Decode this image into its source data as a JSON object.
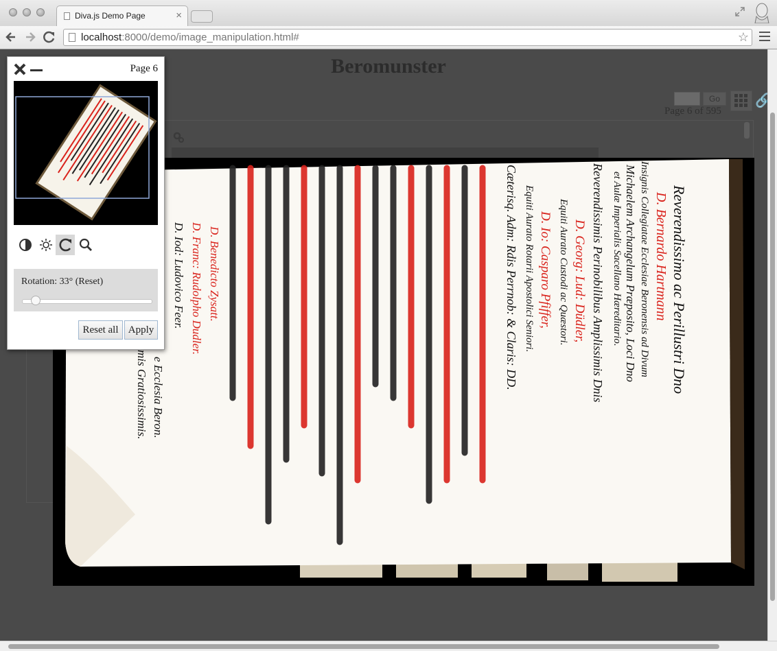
{
  "browser": {
    "tab_title": "Diva.js Demo Page",
    "tab_close": "×",
    "url_host": "localhost",
    "url_path": ":8000/demo/image_manipulation.html#",
    "star": "☆"
  },
  "page": {
    "title": "Beromunster",
    "go_label": "Go",
    "page_count": "Page 6 of 595"
  },
  "panel": {
    "page_label": "Page 6",
    "rotation_label": "Rotation: 33° (Reset)",
    "rotation_degrees": 33,
    "reset_all_label": "Reset all",
    "apply_label": "Apply",
    "tools": [
      "contrast-icon",
      "brightness-icon",
      "rotate-icon",
      "zoom-icon"
    ],
    "active_tool": "rotate-icon"
  },
  "manuscript_text": {
    "col1_lines": [
      "Reverendissimo ac Perillustri Dno",
      "D. Bernardo Hartmann",
      "Insignis Collegiatae Ecclesiae Beronensis ad Divum",
      "Michaelem Archangelum Præposito, Loci Dno",
      "et Aulæ Imperialis Sacellano Hæreditario."
    ],
    "col2_lines": [
      "Reverendissimis Perinobilibus Amplissimis Dnis",
      "D. Georg: Lud: Düdler,",
      "Equiti Aurato Custodi ac Quæstori.",
      "D. Io: Casparo Pfiffer,",
      "Equiti Aurato Rotarii Apostolici Seniori.",
      "Cæterisq. Adm: Rdis Perrnob: & Claris: DD."
    ],
    "names_black": [
      "D. Iod: Ludovico Feer."
    ],
    "names_red": [
      "D. Franc: Rudolpho Dudler.",
      "D. Benedicto Zysatt."
    ],
    "continuation": [
      "mis Gratiosissimis.",
      "e Ecclesia Beron."
    ]
  }
}
